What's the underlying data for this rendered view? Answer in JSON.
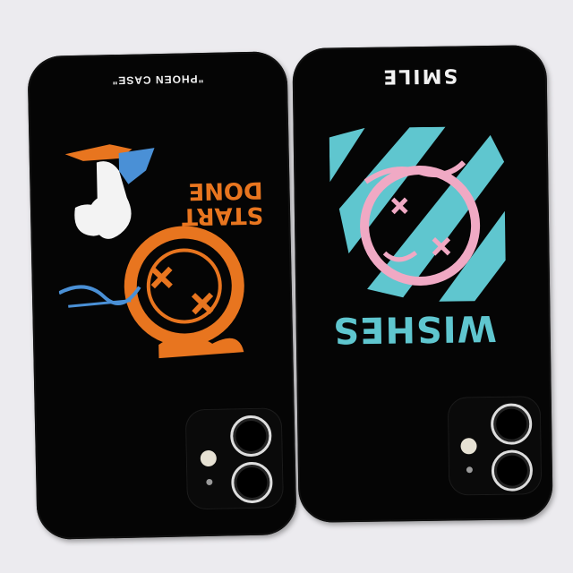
{
  "left_case": {
    "top_text": "\"PHOEN CASE\"",
    "art_text": "START DONE"
  },
  "right_case": {
    "top_text": "SMILE",
    "bottom_text": "WISHES"
  },
  "colors": {
    "case": "#050505",
    "orange": "#e8751f",
    "blue": "#4a90d6",
    "cyan": "#5fc6cf",
    "pink": "#f0a9c4"
  }
}
